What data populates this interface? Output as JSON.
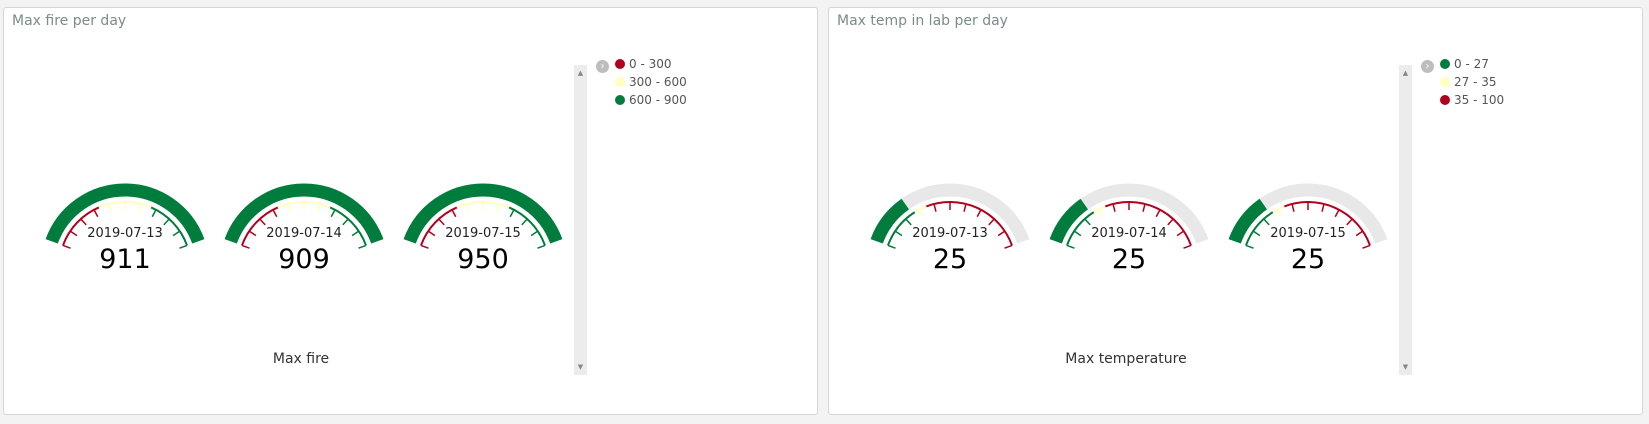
{
  "colors": {
    "red": "#b0001e",
    "yellow": "#ffffbf",
    "green": "#007c3c",
    "track": "#e8e8e8"
  },
  "panels": [
    {
      "title": "Max fire per day",
      "axis_title": "Max fire",
      "legend": [
        {
          "label": "0 - 300",
          "color": "red"
        },
        {
          "label": "300 - 600",
          "color": "yellow"
        },
        {
          "label": "600 - 900",
          "color": "green"
        }
      ],
      "gauges": [
        {
          "label": "2019-07-13",
          "value": "911"
        },
        {
          "label": "2019-07-14",
          "value": "909"
        },
        {
          "label": "2019-07-15",
          "value": "950"
        }
      ]
    },
    {
      "title": "Max temp in lab per day",
      "axis_title": "Max temperature",
      "legend": [
        {
          "label": "0 - 27",
          "color": "green"
        },
        {
          "label": "27 - 35",
          "color": "yellow"
        },
        {
          "label": "35 - 100",
          "color": "red"
        }
      ],
      "gauges": [
        {
          "label": "2019-07-13",
          "value": "25"
        },
        {
          "label": "2019-07-14",
          "value": "25"
        },
        {
          "label": "2019-07-15",
          "value": "25"
        }
      ]
    }
  ],
  "chart_data": [
    {
      "type": "gauge",
      "title": "Max fire per day",
      "xlabel": "Max fire",
      "range": [
        0,
        900
      ],
      "bands": [
        {
          "from": 0,
          "to": 300,
          "color": "red",
          "label": "0 - 300"
        },
        {
          "from": 300,
          "to": 600,
          "color": "yellow",
          "label": "300 - 600"
        },
        {
          "from": 600,
          "to": 900,
          "color": "green",
          "label": "600 - 900"
        }
      ],
      "categories": [
        "2019-07-13",
        "2019-07-14",
        "2019-07-15"
      ],
      "values": [
        911,
        909,
        950
      ],
      "fill_fraction": [
        1,
        1,
        1
      ],
      "fill_color": "green"
    },
    {
      "type": "gauge",
      "title": "Max temp in lab per day",
      "xlabel": "Max temperature",
      "range": [
        0,
        100
      ],
      "bands": [
        {
          "from": 0,
          "to": 27,
          "color": "green",
          "label": "0 - 27"
        },
        {
          "from": 27,
          "to": 35,
          "color": "yellow",
          "label": "27 - 35"
        },
        {
          "from": 35,
          "to": 100,
          "color": "red",
          "label": "35 - 100"
        }
      ],
      "categories": [
        "2019-07-13",
        "2019-07-14",
        "2019-07-15"
      ],
      "values": [
        25,
        25,
        25
      ],
      "fill_fraction": [
        0.25,
        0.25,
        0.25
      ],
      "fill_color": "green"
    }
  ]
}
